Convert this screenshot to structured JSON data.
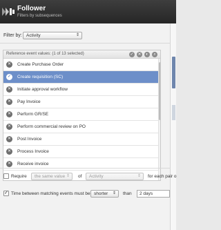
{
  "header": {
    "title": "Follower",
    "subtitle": "Filters by subsequences",
    "logo_icon": "follower-logo-icon"
  },
  "filter": {
    "label": "Filter by:",
    "selected": "Activity"
  },
  "list": {
    "header_label": "Reference event values:",
    "selection_count": "(1 of 13 selected)",
    "header_icons": [
      "select-all-icon",
      "deselect-all-icon",
      "invert-icon",
      "search-icon"
    ],
    "items": [
      {
        "label": "Create Purchase Order",
        "selected": false
      },
      {
        "label": "Create requisition (SC)",
        "selected": true
      },
      {
        "label": "Initiate approval workflow",
        "selected": false
      },
      {
        "label": "Pay Invoice",
        "selected": false
      },
      {
        "label": "Perform GR/SE",
        "selected": false
      },
      {
        "label": "Perform commercial review on PO",
        "selected": false
      },
      {
        "label": "Post Invoice",
        "selected": false
      },
      {
        "label": "Process Invoice",
        "selected": false
      },
      {
        "label": "Receive invoice",
        "selected": false
      }
    ]
  },
  "require_option": {
    "checked": false,
    "label": "Require",
    "value_select": "the same value",
    "of_text": "of",
    "attribute_select": "Activity",
    "suffix": "for each pair o"
  },
  "time_option": {
    "checked": true,
    "label": "Time between matching events must be",
    "comparison_select": "shorter",
    "than_text": "than",
    "duration_select": "2 days"
  },
  "colors": {
    "header_bg": "#2f2f2f",
    "selected_row": "#6d8fc9",
    "panel_bg": "#f2f2f2"
  }
}
